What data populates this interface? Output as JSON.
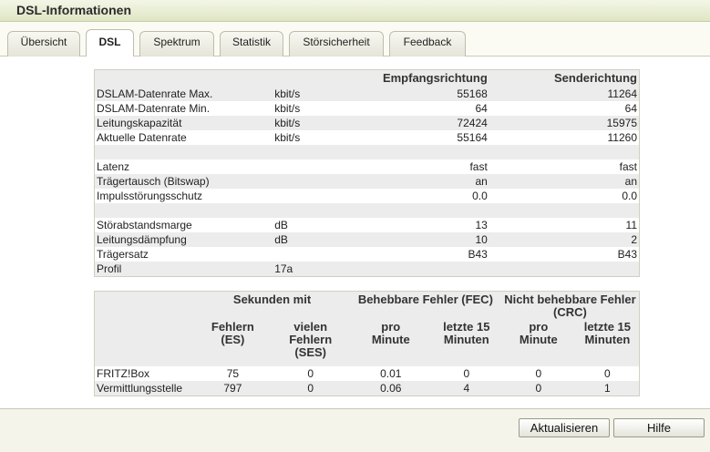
{
  "window": {
    "title": "DSL-Informationen"
  },
  "tabs": [
    {
      "label": "Übersicht"
    },
    {
      "label": "DSL"
    },
    {
      "label": "Spektrum"
    },
    {
      "label": "Statistik"
    },
    {
      "label": "Störsicherheit"
    },
    {
      "label": "Feedback"
    }
  ],
  "active_tab": "DSL",
  "line_table": {
    "headers": {
      "col1": "",
      "col2": "",
      "col3": "Empfangsrichtung",
      "col4": "Senderichtung"
    },
    "rows": [
      {
        "label": "DSLAM-Datenrate Max.",
        "unit": "kbit/s",
        "rx": "55168",
        "tx": "11264"
      },
      {
        "label": "DSLAM-Datenrate Min.",
        "unit": "kbit/s",
        "rx": "64",
        "tx": "64"
      },
      {
        "label": "Leitungskapazität",
        "unit": "kbit/s",
        "rx": "72424",
        "tx": "15975"
      },
      {
        "label": "Aktuelle Datenrate",
        "unit": "kbit/s",
        "rx": "55164",
        "tx": "11260"
      },
      {
        "label": "",
        "unit": "",
        "rx": "",
        "tx": ""
      },
      {
        "label": "Latenz",
        "unit": "",
        "rx": "fast",
        "tx": "fast"
      },
      {
        "label": "Trägertausch (Bitswap)",
        "unit": "",
        "rx": "an",
        "tx": "an"
      },
      {
        "label": "Impulsstörungsschutz",
        "unit": "",
        "rx": "0.0",
        "tx": "0.0"
      },
      {
        "label": "",
        "unit": "",
        "rx": "",
        "tx": ""
      },
      {
        "label": "Störabstandsmarge",
        "unit": "dB",
        "rx": "13",
        "tx": "11"
      },
      {
        "label": "Leitungsdämpfung",
        "unit": "dB",
        "rx": "10",
        "tx": "2"
      },
      {
        "label": "Trägersatz",
        "unit": "",
        "rx": "B43",
        "tx": "B43"
      },
      {
        "label": "Profil",
        "unit": "17a",
        "rx": "",
        "tx": ""
      }
    ]
  },
  "error_table": {
    "group_headers": {
      "seconds": "Sekunden mit",
      "fec": "Behebbare Fehler (FEC)",
      "crc": "Nicht behebbare Fehler (CRC)"
    },
    "sub_headers": {
      "es": "Fehlern (ES)",
      "ses": "vielen Fehlern (SES)",
      "fec_min": "pro Minute",
      "fec_15": "letzte 15 Minuten",
      "crc_min": "pro Minute",
      "crc_15": "letzte 15 Minuten"
    },
    "rows": [
      {
        "label": "FRITZ!Box",
        "es": "75",
        "ses": "0",
        "fec_min": "0.01",
        "fec_15": "0",
        "crc_min": "0",
        "crc_15": "0"
      },
      {
        "label": "Vermittlungsstelle",
        "es": "797",
        "ses": "0",
        "fec_min": "0.06",
        "fec_15": "4",
        "crc_min": "0",
        "crc_15": "1"
      }
    ]
  },
  "buttons": {
    "refresh": "Aktualisieren",
    "help": "Hilfe"
  }
}
